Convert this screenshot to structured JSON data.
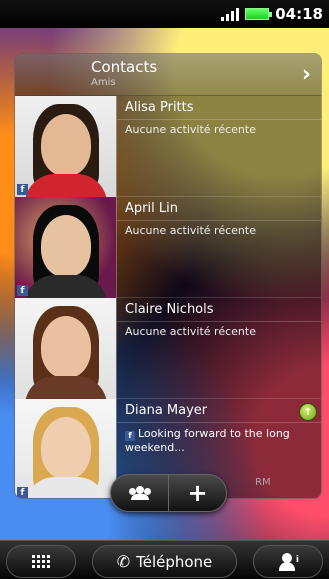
{
  "status_bar": {
    "time": "04:18"
  },
  "widget": {
    "title": "Contacts",
    "subtitle": "Amis",
    "contacts": [
      {
        "name": "Alisa Pritts",
        "activity": "Aucune activité récente"
      },
      {
        "name": "April Lin",
        "activity": "Aucune activité récente"
      },
      {
        "name": "Claire Nichols",
        "activity": "Aucune activité récente"
      },
      {
        "name": "Diana Mayer",
        "post": "Looking forward to the long weekend...",
        "post_meta": "RM"
      }
    ]
  },
  "actions": {
    "add_label": "+"
  },
  "bottom_bar": {
    "phone_label": "Téléphone",
    "phone_glyph": "✆"
  },
  "colors": {
    "facebook": "#3b5998",
    "online": "#8bc34a"
  },
  "icons": [
    "signal-icon",
    "battery-icon",
    "contact-card-icon",
    "chevron-right-icon",
    "facebook-icon",
    "online-status-icon",
    "group-icon",
    "plus-icon",
    "apps-grid-icon",
    "phone-icon",
    "people-info-icon"
  ]
}
